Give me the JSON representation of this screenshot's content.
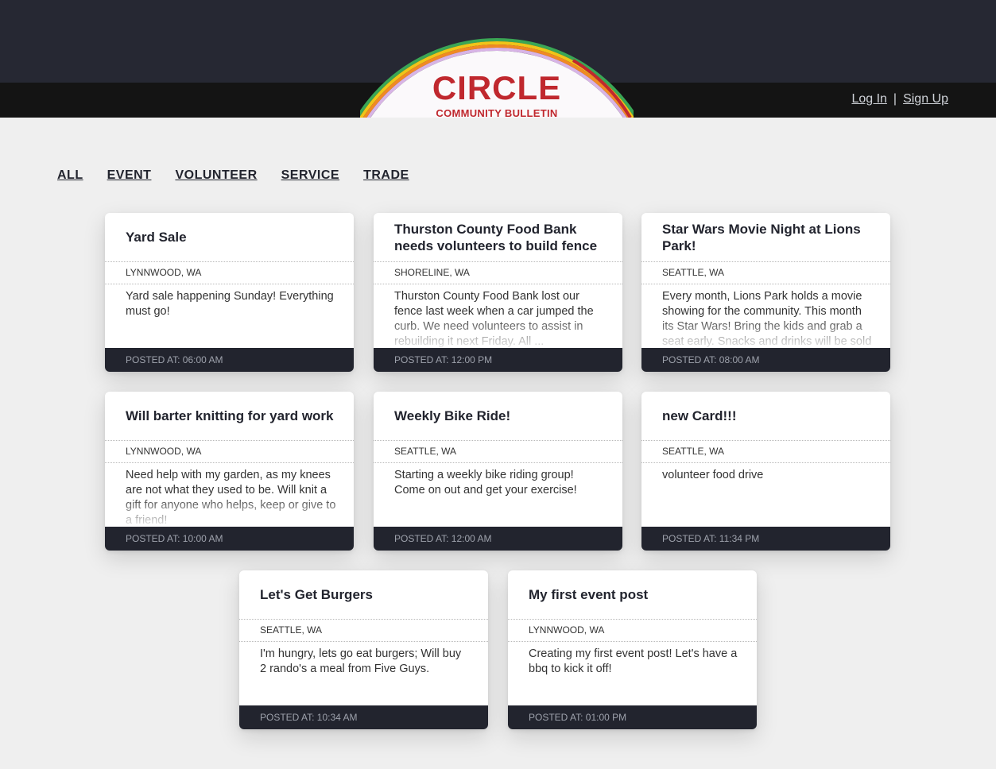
{
  "header": {
    "brand_title": "CIRCLE",
    "brand_subtitle": "COMMUNITY BULLETIN",
    "login_label": "Log In",
    "separator": "|",
    "signup_label": "Sign Up"
  },
  "colors": {
    "top_band": "#262833",
    "nav_bar": "#141414",
    "brand_red": "#c0282e",
    "card_footer": "#22242e",
    "page_bg": "#efefef"
  },
  "filters": [
    "ALL",
    "EVENT",
    "VOLUNTEER",
    "SERVICE",
    "TRADE"
  ],
  "cards": [
    {
      "title": "Yard Sale",
      "location": "LYNNWOOD, WA",
      "body": "Yard sale happening Sunday! Everything must go!",
      "posted": "POSTED AT: 06:00 AM"
    },
    {
      "title": "Thurston County Food Bank needs volunteers to build fence",
      "location": "SHORELINE, WA",
      "body": "Thurston County Food Bank lost our fence last week when a car jumped the curb. We need volunteers to assist in rebuilding it next Friday. All ...",
      "posted": "POSTED AT: 12:00 PM"
    },
    {
      "title": "Star Wars Movie Night at Lions Park!",
      "location": "SEATTLE, WA",
      "body": "Every month, Lions Park holds a movie showing for the community. This month its Star Wars! Bring the kids and grab a seat early. Snacks and drinks will be sold ...",
      "posted": "POSTED AT: 08:00 AM"
    },
    {
      "title": "Will barter knitting for yard work",
      "location": "LYNNWOOD, WA",
      "body": "Need help with my garden, as my knees are not what they used to be. Will knit a gift for anyone who helps, keep or give to a friend!",
      "posted": "POSTED AT: 10:00 AM"
    },
    {
      "title": "Weekly Bike Ride!",
      "location": "SEATTLE, WA",
      "body": "Starting a weekly bike riding group! Come on out and get your exercise!",
      "posted": "POSTED AT: 12:00 AM"
    },
    {
      "title": "new Card!!!",
      "location": "SEATTLE, WA",
      "body": "volunteer food drive",
      "posted": "POSTED AT: 11:34 PM"
    },
    {
      "title": "Let's Get Burgers",
      "location": "SEATTLE, WA",
      "body": "I'm hungry, lets go eat burgers; Will buy 2 rando's a meal from Five Guys.",
      "posted": "POSTED AT: 10:34 AM"
    },
    {
      "title": "My first event post",
      "location": "LYNNWOOD, WA",
      "body": "Creating my first event post! Let's have a bbq to kick it off!",
      "posted": "POSTED AT: 01:00 PM"
    }
  ]
}
